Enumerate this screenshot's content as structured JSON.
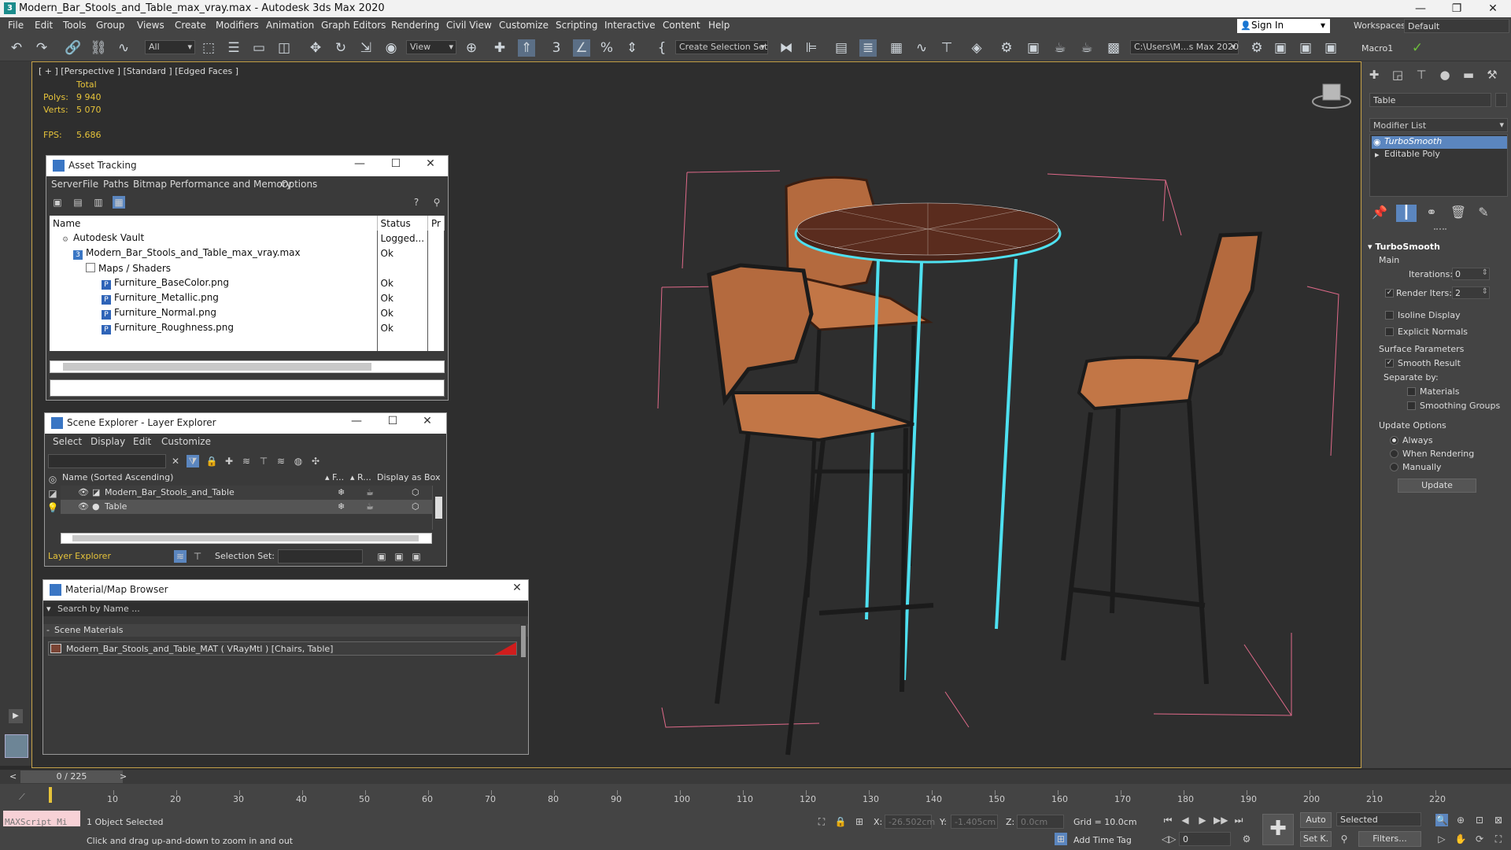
{
  "window": {
    "title": "Modern_Bar_Stools_and_Table_max_vray.max - Autodesk 3ds Max 2020",
    "app_icon": "3"
  },
  "menu": [
    "File",
    "Edit",
    "Tools",
    "Group",
    "Views",
    "Create",
    "Modifiers",
    "Animation",
    "Graph Editors",
    "Rendering",
    "Civil View",
    "Customize",
    "Scripting",
    "Interactive",
    "Content",
    "Help"
  ],
  "account": {
    "sign_in": "Sign In",
    "workspaces_label": "Workspaces:",
    "workspace": "Default"
  },
  "toolbar": {
    "selection_filter": "All",
    "ref_coord": "View",
    "selection_set": "Create Selection Set",
    "project_path": "C:\\Users\\M...s Max 2020",
    "macro": "Macro1"
  },
  "viewport": {
    "label": "[ + ] [Perspective ] [Standard ] [Edged Faces ]",
    "stats": {
      "total_label": "Total",
      "polys_label": "Polys:",
      "polys": "9 940",
      "verts_label": "Verts:",
      "verts": "5 070",
      "fps_label": "FPS:",
      "fps": "5.686"
    }
  },
  "asset_tracking": {
    "title": "Asset Tracking",
    "menu": [
      "Server",
      "File",
      "Paths",
      "Bitmap Performance and Memory",
      "Options"
    ],
    "columns": [
      "Name",
      "Status",
      "Pr"
    ],
    "rows": [
      {
        "name": "Autodesk Vault",
        "status": "Logged..."
      },
      {
        "name": "Modern_Bar_Stools_and_Table_max_vray.max",
        "status": "Ok"
      },
      {
        "name": "Maps / Shaders",
        "status": ""
      },
      {
        "name": "Furniture_BaseColor.png",
        "status": "Ok"
      },
      {
        "name": "Furniture_Metallic.png",
        "status": "Ok"
      },
      {
        "name": "Furniture_Normal.png",
        "status": "Ok"
      },
      {
        "name": "Furniture_Roughness.png",
        "status": "Ok"
      }
    ]
  },
  "scene_explorer": {
    "title": "Scene Explorer - Layer Explorer",
    "menu": [
      "Select",
      "Display",
      "Edit",
      "Customize"
    ],
    "columns": [
      "Name (Sorted Ascending)",
      "▴ F...",
      "▴ R...",
      "Display as Box"
    ],
    "rows": [
      {
        "name": "Modern_Bar_Stools_and_Table"
      },
      {
        "name": "Table"
      }
    ],
    "footer_label": "Layer Explorer",
    "selection_set_label": "Selection Set:"
  },
  "material_browser": {
    "title": "Material/Map Browser",
    "search_placeholder": "Search by Name ...",
    "group": "Scene Materials",
    "item": "Modern_Bar_Stools_and_Table_MAT  ( VRayMtl )  [Chairs, Table]"
  },
  "command_panel": {
    "object_name": "Table",
    "modifier_list": "Modifier List",
    "stack": [
      "TurboSmooth",
      "Editable Poly"
    ],
    "rollout": "TurboSmooth",
    "main_label": "Main",
    "iterations_label": "Iterations:",
    "iterations": "0",
    "render_iters_label": "Render Iters:",
    "render_iters": "2",
    "isoline": "Isoline Display",
    "explicit": "Explicit Normals",
    "surface_params": "Surface Parameters",
    "smooth_result": "Smooth Result",
    "separate_by": "Separate by:",
    "materials": "Materials",
    "smoothing_groups": "Smoothing Groups",
    "update_options": "Update Options",
    "always": "Always",
    "when_rendering": "When Rendering",
    "manually": "Manually",
    "update_btn": "Update"
  },
  "timeline": {
    "frame": "0 / 225",
    "ticks": [
      "10",
      "20",
      "30",
      "40",
      "50",
      "60",
      "70",
      "80",
      "90",
      "100",
      "110",
      "120",
      "130",
      "140",
      "150",
      "160",
      "170",
      "180",
      "190",
      "200",
      "210",
      "220"
    ]
  },
  "status": {
    "maxscript": "MAXScript Mi",
    "selected": "1 Object Selected",
    "prompt": "Click and drag up-and-down to zoom in and out",
    "x_label": "X:",
    "x": "-26.502cm",
    "y_label": "Y:",
    "y": "-1.405cm",
    "z_label": "Z:",
    "z": "0.0cm",
    "grid": "Grid = 10.0cm",
    "add_time_tag": "Add Time Tag",
    "auto": "Auto",
    "set_key": "Set K.",
    "selected_dropdown": "Selected",
    "filters": "Filters...",
    "frame_field": "0"
  },
  "colors": {
    "accent": "#5b86bf",
    "stats": "#e6c33a",
    "selection": "#4ee0f0",
    "bbox": "#e06a8a"
  }
}
